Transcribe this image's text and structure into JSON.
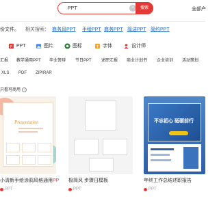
{
  "search": {
    "value": "PPT",
    "button_label": "搜索"
  },
  "header": {
    "all_products": "全部产"
  },
  "related": {
    "left_label": "份文件。",
    "title": "相关搜索：",
    "links": [
      "商务风PPT",
      "手绘PPT",
      "商务PPT",
      "简洁PPT",
      "简约PPT"
    ]
  },
  "types": [
    {
      "icon": "ppt-icon",
      "label": "PPT"
    },
    {
      "icon": "image-icon",
      "label": "图片"
    },
    {
      "icon": "flower-icon",
      "label": "图标"
    },
    {
      "icon": "font-icon",
      "label": "字体"
    },
    {
      "icon": "designer-icon",
      "label": "设计师"
    }
  ],
  "categories": [
    "汇报",
    "教学通用PPT",
    "毕业答辩",
    "节日PPT",
    "述职汇报",
    "商业计划书",
    "企业培训",
    "活动策划"
  ],
  "formats": [
    "XLS",
    "PDF",
    "ZIP/RAR"
  ],
  "filter": {
    "label": "只看可商用"
  },
  "cards": [
    {
      "title": "小清新手绘涂鸦风格通用",
      "title_accent": "PP",
      "meta": "PPT"
    },
    {
      "title": "极简风 步骤日模板",
      "meta": "PPT"
    },
    {
      "title": "年终工作总结述职报告",
      "meta": "PPT"
    }
  ],
  "thumbs": {
    "card1_word": "Presentation",
    "card3_title": "不忘初心 砥砺前行"
  },
  "colors": {
    "accent": "#e53935",
    "link": "#1565c0"
  }
}
